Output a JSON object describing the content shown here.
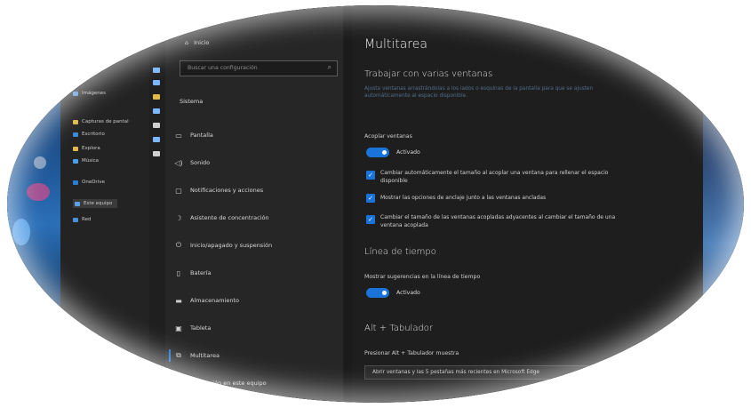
{
  "colors": {
    "accent": "#1a73d8",
    "background": "#1e1e1e",
    "sidebar": "#262626"
  },
  "explorer": {
    "items": [
      {
        "label": "Imágenes",
        "icon": "pictures-icon"
      },
      {
        "label": "Capturas de pantal",
        "icon": "folder-icon"
      },
      {
        "label": "Escritorio",
        "icon": "desktop-icon"
      },
      {
        "label": "Explora",
        "icon": "folder-icon"
      },
      {
        "label": "Música",
        "icon": "music-icon"
      },
      {
        "label": "OneDrive",
        "icon": "cloud-icon"
      },
      {
        "label": "Este equipo",
        "icon": "computer-icon"
      },
      {
        "label": "Red",
        "icon": "network-icon"
      }
    ]
  },
  "sidebar": {
    "home": "Inicio",
    "search_placeholder": "Buscar una configuración",
    "section": "Sistema",
    "items": [
      {
        "label": "Pantalla",
        "icon": "monitor-icon"
      },
      {
        "label": "Sonido",
        "icon": "speaker-icon"
      },
      {
        "label": "Notificaciones y acciones",
        "icon": "notification-icon"
      },
      {
        "label": "Asistente de concentración",
        "icon": "moon-icon"
      },
      {
        "label": "Inicio/apagado y suspensión",
        "icon": "power-icon"
      },
      {
        "label": "Batería",
        "icon": "battery-icon"
      },
      {
        "label": "Almacenamiento",
        "icon": "storage-icon"
      },
      {
        "label": "Tableta",
        "icon": "tablet-icon"
      },
      {
        "label": "Multitarea",
        "icon": "multitask-icon",
        "active": true
      },
      {
        "label": "Proyección en este equipo",
        "icon": "projection-icon"
      }
    ]
  },
  "main": {
    "title": "Multitarea",
    "snap": {
      "heading": "Trabajar con varias ventanas",
      "description": "Ajusta ventanas arrastrándolas a los lados o esquinas de la pantalla para que se ajusten automáticamente al espacio disponible.",
      "toggle_label": "Acoplar ventanas",
      "toggle_state": "Activado",
      "options": [
        "Cambiar automáticamente el tamaño al acoplar una ventana para rellenar el espacio disponible",
        "Mostrar las opciones de anclaje junto a las ventanas ancladas",
        "Cambiar el tamaño de las ventanas acopladas adyacentes al cambiar el tamaño de una ventana acoplada"
      ]
    },
    "timeline": {
      "heading": "Línea de tiempo",
      "toggle_label": "Mostrar sugerencias en la línea de tiempo",
      "toggle_state": "Activado"
    },
    "alttab": {
      "heading": "Alt + Tabulador",
      "label": "Presionar Alt + Tabulador muestra",
      "selected": "Abrir ventanas y las 5 pestañas más recientes en Microsoft Edge"
    }
  }
}
